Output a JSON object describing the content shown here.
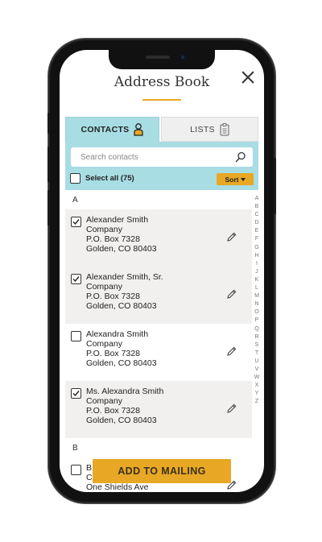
{
  "header": {
    "title": "Address Book"
  },
  "tabs": [
    {
      "label": "CONTACTS",
      "icon": "person-icon",
      "active": true
    },
    {
      "label": "LISTS",
      "icon": "clipboard-icon",
      "active": false
    }
  ],
  "search": {
    "placeholder": "Search contacts"
  },
  "select_all": {
    "label": "Select all (75)",
    "checked": false
  },
  "sort": {
    "label": "Sort"
  },
  "sections": [
    {
      "letter": "A",
      "contacts": [
        {
          "name": "Alexander Smith",
          "company": "Company",
          "address": "P.O. Box 7328",
          "city": "Golden, CO 80403",
          "checked": true
        },
        {
          "name": "Alexander Smith, Sr.",
          "company": "Company",
          "address": "P.O. Box 7328",
          "city": "Golden, CO 80403",
          "checked": true
        },
        {
          "name": "Alexandra Smith",
          "company": "Company",
          "address": "P.O. Box 7328",
          "city": "Golden, CO 80403",
          "checked": false
        },
        {
          "name": "Ms. Alexandra Smith",
          "company": "Company",
          "address": "P.O. Box 7328",
          "city": "Golden, CO 80403",
          "checked": true
        }
      ]
    },
    {
      "letter": "B",
      "contacts": [
        {
          "name": "B",
          "company": "C",
          "address": "One Shields Ave",
          "checked": false
        }
      ]
    }
  ],
  "alphabet": [
    "A",
    "B",
    "C",
    "D",
    "E",
    "F",
    "G",
    "H",
    "I",
    "J",
    "K",
    "L",
    "M",
    "N",
    "O",
    "P",
    "Q",
    "R",
    "S",
    "T",
    "U",
    "V",
    "W",
    "X",
    "Y",
    "Z"
  ],
  "action": {
    "label": "ADD TO MAILING"
  },
  "colors": {
    "accent": "#e8a825",
    "tab_active": "#a8dde4",
    "row_alt": "#f1f0ef"
  }
}
